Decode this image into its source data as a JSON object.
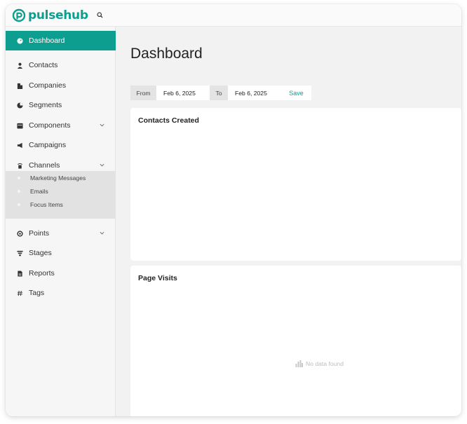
{
  "app": {
    "brand": "pulsehub",
    "brand_color": "#0d9e90"
  },
  "search": {
    "icon": "search-icon"
  },
  "sidebar": {
    "items": [
      {
        "label": "Dashboard",
        "icon": "dashboard-icon",
        "active": true
      },
      {
        "label": "Contacts",
        "icon": "person-icon"
      },
      {
        "label": "Companies",
        "icon": "building-icon"
      },
      {
        "label": "Segments",
        "icon": "pie-chart-icon"
      },
      {
        "label": "Components",
        "icon": "calendar-icon",
        "expandable": true
      },
      {
        "label": "Campaigns",
        "icon": "megaphone-icon"
      },
      {
        "label": "Channels",
        "icon": "channels-icon",
        "expandable": true,
        "expanded": true
      },
      {
        "label": "Points",
        "icon": "points-icon",
        "expandable": true
      },
      {
        "label": "Stages",
        "icon": "filter-icon"
      },
      {
        "label": "Reports",
        "icon": "report-icon"
      },
      {
        "label": "Tags",
        "icon": "hash-icon"
      }
    ],
    "channels_submenu": [
      {
        "label": "Marketing Messages"
      },
      {
        "label": "Emails"
      },
      {
        "label": "Focus Items"
      }
    ]
  },
  "main": {
    "title": "Dashboard",
    "date_filter": {
      "from_label": "From",
      "from_value": "Feb 6, 2025",
      "to_label": "To",
      "to_value": "Feb 6, 2025",
      "save_label": "Save"
    },
    "cards": [
      {
        "title": "Contacts Created"
      },
      {
        "title": "Page Visits",
        "empty_text": "No data found"
      }
    ]
  }
}
